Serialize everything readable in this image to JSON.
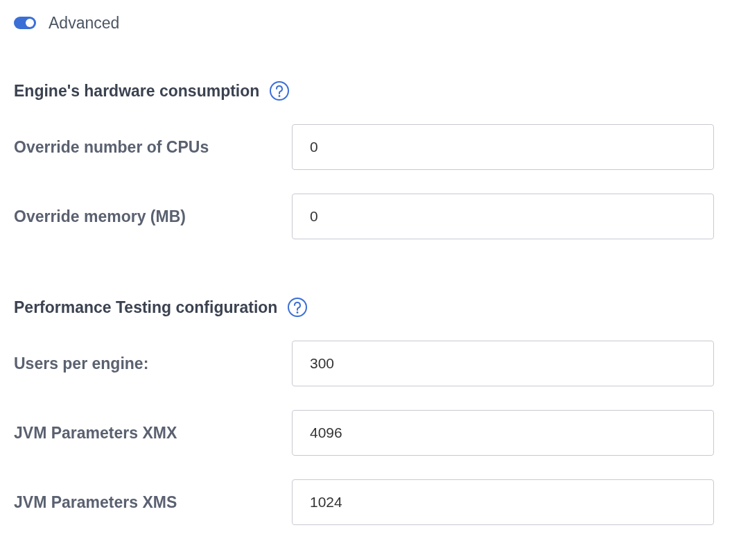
{
  "advanced_toggle": {
    "label": "Advanced",
    "on": true
  },
  "sections": [
    {
      "title": "Engine's hardware consumption",
      "fields": [
        {
          "label": "Override number of CPUs",
          "value": "0"
        },
        {
          "label": "Override memory (MB)",
          "value": "0"
        }
      ]
    },
    {
      "title": "Performance Testing configuration",
      "fields": [
        {
          "label": "Users per engine:",
          "value": "300"
        },
        {
          "label": "JVM Parameters XMX",
          "value": "4096"
        },
        {
          "label": "JVM Parameters XMS",
          "value": "1024"
        }
      ]
    }
  ]
}
